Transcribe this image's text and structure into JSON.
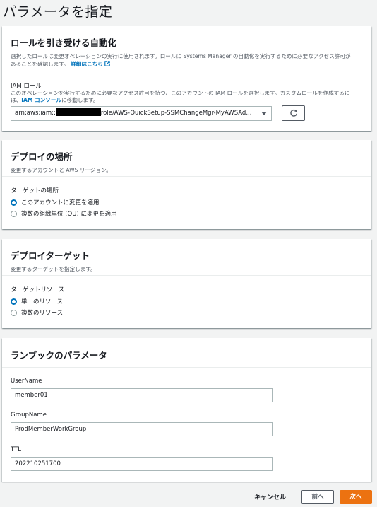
{
  "page": {
    "title": "パラメータを指定"
  },
  "automation": {
    "title": "ロールを引き受ける自動化",
    "desc_line1": "選択したロールは変更オペレーションの実行に使用されます。ロールに Systems Manager の自動化を実行するために必要なアクセス許可が",
    "desc_line2": "あることを確認します。",
    "desc_link": "詳細はこちら",
    "iam_label": "IAM ロール",
    "iam_desc_line1": "このオペレーションを実行するために必要なアクセス許可を持つ、このアカウントの IAM ロールを選択します。カスタムロールを作成するに",
    "iam_desc_prefix": "は、",
    "iam_console_link": "IAM コンソール",
    "iam_desc_suffix": "に移動します。",
    "role_prefix": "arn:aws:iam::",
    "role_suffix": "role/AWS-QuickSetup-SSMChangeMgr-MyAWSAd..."
  },
  "deploy_location": {
    "title": "デプロイの場所",
    "desc": "変更するアカウントと AWS リージョン。",
    "target_label": "ターゲットの場所",
    "options": [
      "このアカウントに変更を適用",
      "複数の組織単位 (OU) に変更を適用"
    ],
    "selected": 0
  },
  "deploy_target": {
    "title": "デプロイターゲット",
    "desc": "変更するターゲットを指定します。",
    "resource_label": "ターゲットリソース",
    "options": [
      "単一のリソース",
      "複数のリソース"
    ],
    "selected": 0
  },
  "runbook": {
    "title": "ランブックのパラメータ",
    "username_label": "UserName",
    "username_value": "member01",
    "groupname_label": "GroupName",
    "groupname_value": "ProdMemberWorkGroup",
    "ttl_label": "TTL",
    "ttl_value": "202210251700"
  },
  "footer": {
    "cancel": "キャンセル",
    "prev": "前へ",
    "next": "次へ"
  },
  "colors": {
    "accent": "#0073bb",
    "primary_button": "#ec7211",
    "background": "#f2f3f3"
  },
  "icons": [
    "external-link-icon",
    "chevron-down-icon",
    "refresh-icon"
  ]
}
